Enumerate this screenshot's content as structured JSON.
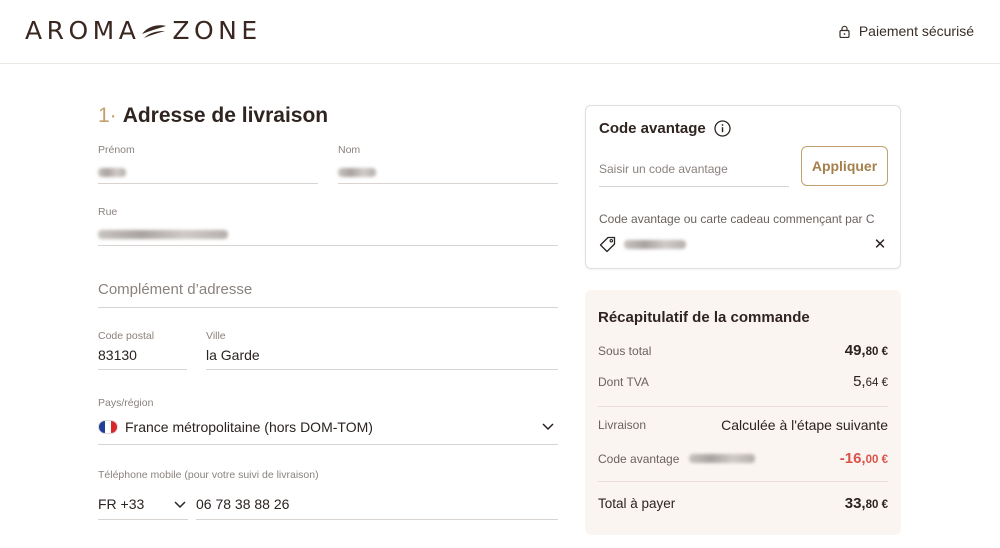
{
  "header": {
    "brand": "AROMA",
    "brand2": "ZONE",
    "secure_label": "Paiement sécurisé"
  },
  "address": {
    "step_num": "1·",
    "title": "Adresse de livraison",
    "fields": {
      "first_name_label": "Prénom",
      "last_name_label": "Nom",
      "street_label": "Rue",
      "complement_placeholder": "Complément d’adresse",
      "postal_label": "Code postal",
      "postal_value": "83130",
      "city_label": "Ville",
      "city_value": "la Garde",
      "country_label": "Pays/région",
      "country_value": "France métropolitaine (hors DOM-TOM)",
      "phone_label": "Téléphone mobile (pour votre suivi de livraison)",
      "phone_prefix": "FR +33",
      "phone_value": "06 78 38 88 26"
    }
  },
  "promo": {
    "title": "Code avantage",
    "placeholder": "Saisir un code avantage",
    "apply_label": "Appliquer",
    "note": "Code avantage ou carte cadeau commençant par C",
    "remove_label": "✕"
  },
  "summary": {
    "title": "Récapitulatif de la commande",
    "subtotal_label": "Sous total",
    "subtotal_int": "49,",
    "subtotal_dec": "80 €",
    "vat_label": "Dont TVA",
    "vat_int": "5,",
    "vat_dec": "64 €",
    "shipping_label": "Livraison",
    "shipping_value": "Calculée à l'étape suivante",
    "discount_label": "Code avantage",
    "discount_int": "-16,",
    "discount_dec": "00 €",
    "total_label": "Total à payer",
    "total_int": "33,",
    "total_dec": "80 €"
  },
  "colors": {
    "accent": "#c2a06f",
    "discount": "#d9534a",
    "summary_bg": "#fbf5f2"
  }
}
